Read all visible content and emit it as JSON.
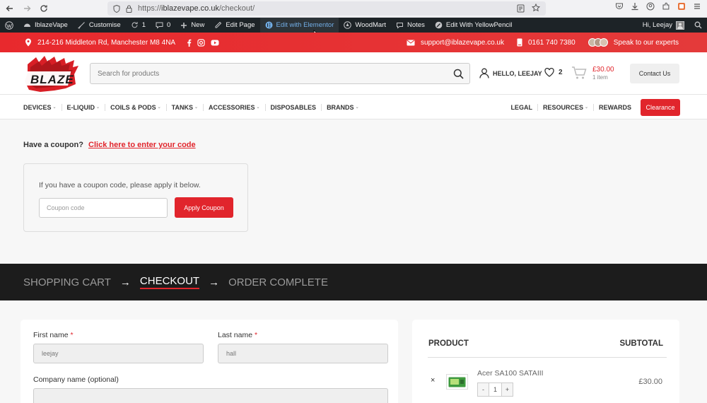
{
  "browser": {
    "url_prefix": "https://",
    "url_domain": "iblazevape.co.uk",
    "url_path": "/checkout/"
  },
  "admin_bar": {
    "site_name": "IblazeVape",
    "customise": "Customise",
    "updates_count": "1",
    "comments_count": "0",
    "new": "New",
    "edit_page": "Edit Page",
    "edit_elementor": "Edit with Elementor",
    "woodmart": "WoodMart",
    "notes": "Notes",
    "yellowpencil": "Edit With YellowPencil",
    "greeting": "Hi, Leejay"
  },
  "topbar": {
    "address": "214-216 Middleton Rd, Manchester M8 4NA",
    "email": "support@iblazevape.co.uk",
    "phone": "0161 740 7380",
    "experts": "Speak to our experts"
  },
  "header": {
    "logo_text": "BLAZE",
    "search_placeholder": "Search for products",
    "account_label": "HELLO, LEEJAY",
    "wishlist_count": "2",
    "cart_price": "£30.00",
    "cart_items": "1 item",
    "contact_label": "Contact Us"
  },
  "nav": {
    "left": [
      {
        "label": "DEVICES",
        "caret": "⌄"
      },
      {
        "label": "E-LIQUID",
        "caret": "⌄"
      },
      {
        "label": "COILS & PODS",
        "caret": "⌄"
      },
      {
        "label": "TANKS",
        "caret": "⌄"
      },
      {
        "label": "ACCESSORIES",
        "caret": "⌄"
      },
      {
        "label": "DISPOSABLES",
        "caret": ""
      },
      {
        "label": "BRANDS",
        "caret": "⌄"
      }
    ],
    "right": [
      {
        "label": "LEGAL",
        "caret": ""
      },
      {
        "label": "RESOURCES",
        "caret": "⌄"
      },
      {
        "label": "REWARDS",
        "caret": ""
      }
    ],
    "clearance": "Clearance"
  },
  "coupon": {
    "question": "Have a coupon?",
    "link": "Click here to enter your code",
    "hint": "If you have a coupon code, please apply it below.",
    "placeholder": "Coupon code",
    "apply": "Apply Coupon"
  },
  "steps": {
    "cart": "SHOPPING CART",
    "checkout": "CHECKOUT",
    "complete": "ORDER COMPLETE",
    "arrow": "→"
  },
  "billing": {
    "first_name_label": "First name",
    "first_name_value": "leejay",
    "last_name_label": "Last name",
    "last_name_value": "hall",
    "company_label": "Company name (optional)",
    "required_mark": "*"
  },
  "order": {
    "product_header": "PRODUCT",
    "subtotal_header": "SUBTOTAL",
    "remove": "×",
    "product_name": "Acer SA100 SATAIII",
    "qty_minus": "-",
    "qty_value": "1",
    "qty_plus": "+",
    "product_subtotal": "£30.00"
  },
  "colors": {
    "brand_red": "#e1252c",
    "admin_bar": "#1d2327",
    "steps_bg": "#1c1c1c"
  }
}
